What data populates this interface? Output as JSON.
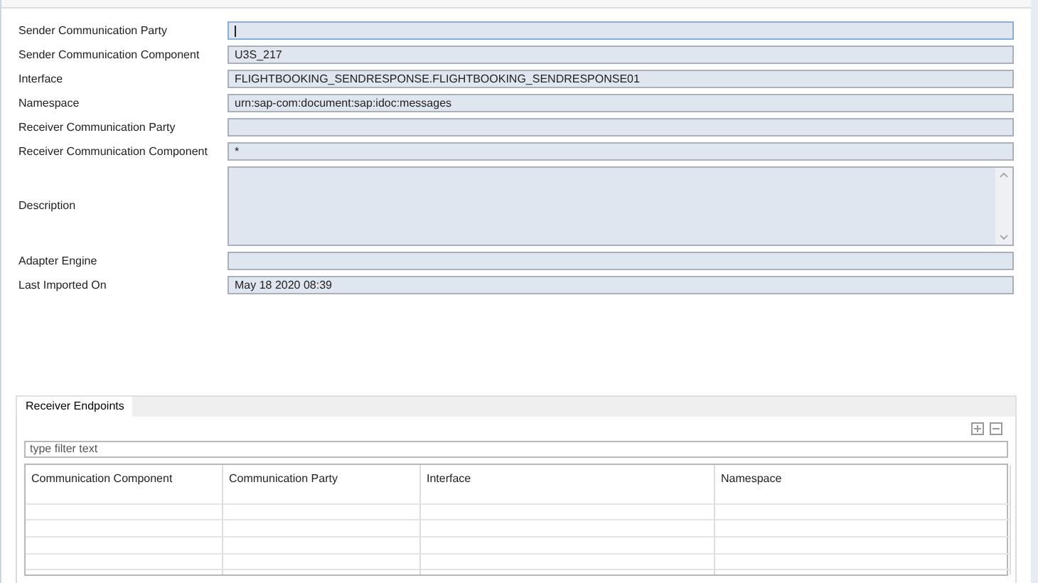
{
  "fields": [
    {
      "label": "Sender Communication Party",
      "kind": "line",
      "focused": true
    },
    {
      "label": "Sender Communication Component",
      "value": "U3S_217",
      "kind": "line",
      "focused": false
    },
    {
      "label": "Interface",
      "value": "FLIGHTBOOKING_SENDRESPONSE.FLIGHTBOOKING_SENDRESPONSE01",
      "kind": "line",
      "focused": false
    },
    {
      "label": "Namespace",
      "value": "urn:sap-com:document:sap:idoc:messages",
      "kind": "line",
      "focused": false
    },
    {
      "label": "Receiver Communication Party",
      "kind": "line",
      "focused": false
    },
    {
      "label": "Receiver Communication Component",
      "value": "*",
      "kind": "line",
      "focused": false
    },
    {
      "label": "Description",
      "kind": "area",
      "focused": false
    },
    {
      "label": "Adapter Engine",
      "kind": "line",
      "focused": false
    },
    {
      "label": "Last Imported On",
      "value": "May 18 2020  08:39",
      "kind": "line",
      "focused": false
    }
  ],
  "tabs": [
    {
      "label": "Receiver Endpoints",
      "selected": true
    }
  ],
  "filter": {
    "placeholder": "type filter text"
  },
  "table": {
    "columns": [
      "Communication Component",
      "Communication Party",
      "Interface",
      "Namespace"
    ]
  }
}
